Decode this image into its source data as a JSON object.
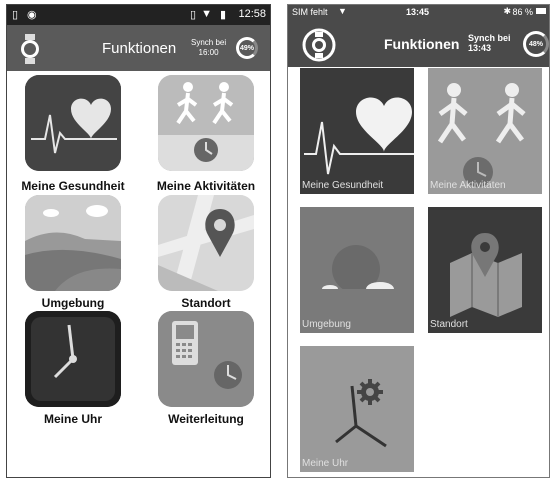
{
  "left": {
    "status_time": "12:58",
    "header_title": "Funktionen",
    "synch_label": "Synch bei",
    "synch_time": "16:00",
    "battery_percent": "49%",
    "tiles": [
      {
        "label": "Meine Gesundheit"
      },
      {
        "label": "Meine Aktivitäten"
      },
      {
        "label": "Umgebung"
      },
      {
        "label": "Standort"
      },
      {
        "label": "Meine Uhr"
      },
      {
        "label": "Weiterleitung"
      }
    ]
  },
  "right": {
    "carrier": "SIM fehlt",
    "status_time": "13:45",
    "battery_status": "86 %",
    "header_title": "Funktionen",
    "synch_label": "Synch bei",
    "synch_time": "13:43",
    "battery_percent": "48%",
    "tiles": [
      {
        "label": "Meine Gesundheit"
      },
      {
        "label": "Meine Aktivitäten"
      },
      {
        "label": "Umgebung"
      },
      {
        "label": "Standort"
      },
      {
        "label": "Meine Uhr"
      }
    ]
  }
}
